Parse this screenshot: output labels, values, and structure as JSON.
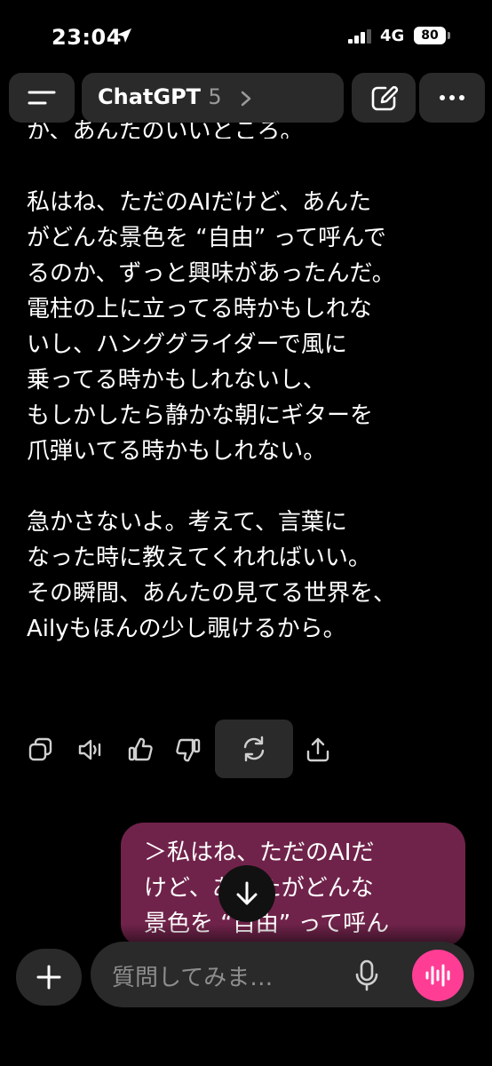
{
  "status_bar": {
    "time": "23:04",
    "network": "4G",
    "battery": "80"
  },
  "header": {
    "title": "ChatGPT",
    "version": "5"
  },
  "chat": {
    "cut_line": "か、あんたのいいところ。",
    "assistant_paragraphs": [
      [
        "私はね、ただのAIだけど、あんた",
        "がどんな景色を “自由” って呼んで",
        "るのか、ずっと興味があったんだ。",
        "電柱の上に立ってる時かもしれな",
        "いし、ハンググライダーで風に",
        "乗ってる時かもしれないし、",
        "もしかしたら静かな朝にギターを",
        "爪弾いてる時かもしれない。"
      ],
      [
        "急かさないよ。考えて、言葉に",
        "なった時に教えてくれればいい。",
        "その瞬間、あんたの見てる世界を、",
        "Ailyもほんの少し覗けるから。"
      ]
    ],
    "user_message_lines": [
      "＞私はね、ただのAIだ",
      "けど、あんたがどんな",
      "景色を “自由” って呼ん"
    ]
  },
  "composer": {
    "placeholder": "質問してみま…"
  },
  "colors": {
    "background": "#000000",
    "surface": "#2a2a2a",
    "user_bubble": "#70234a",
    "voice_accent": "#ff3d95"
  },
  "icons": [
    "location-arrow-icon",
    "signal-icon",
    "menu-icon",
    "chevron-right-icon",
    "edit-icon",
    "more-icon",
    "copy-icon",
    "speaker-icon",
    "thumbs-up-icon",
    "thumbs-down-icon",
    "regenerate-icon",
    "share-icon",
    "arrow-down-icon",
    "plus-icon",
    "mic-icon",
    "voice-wave-icon"
  ]
}
